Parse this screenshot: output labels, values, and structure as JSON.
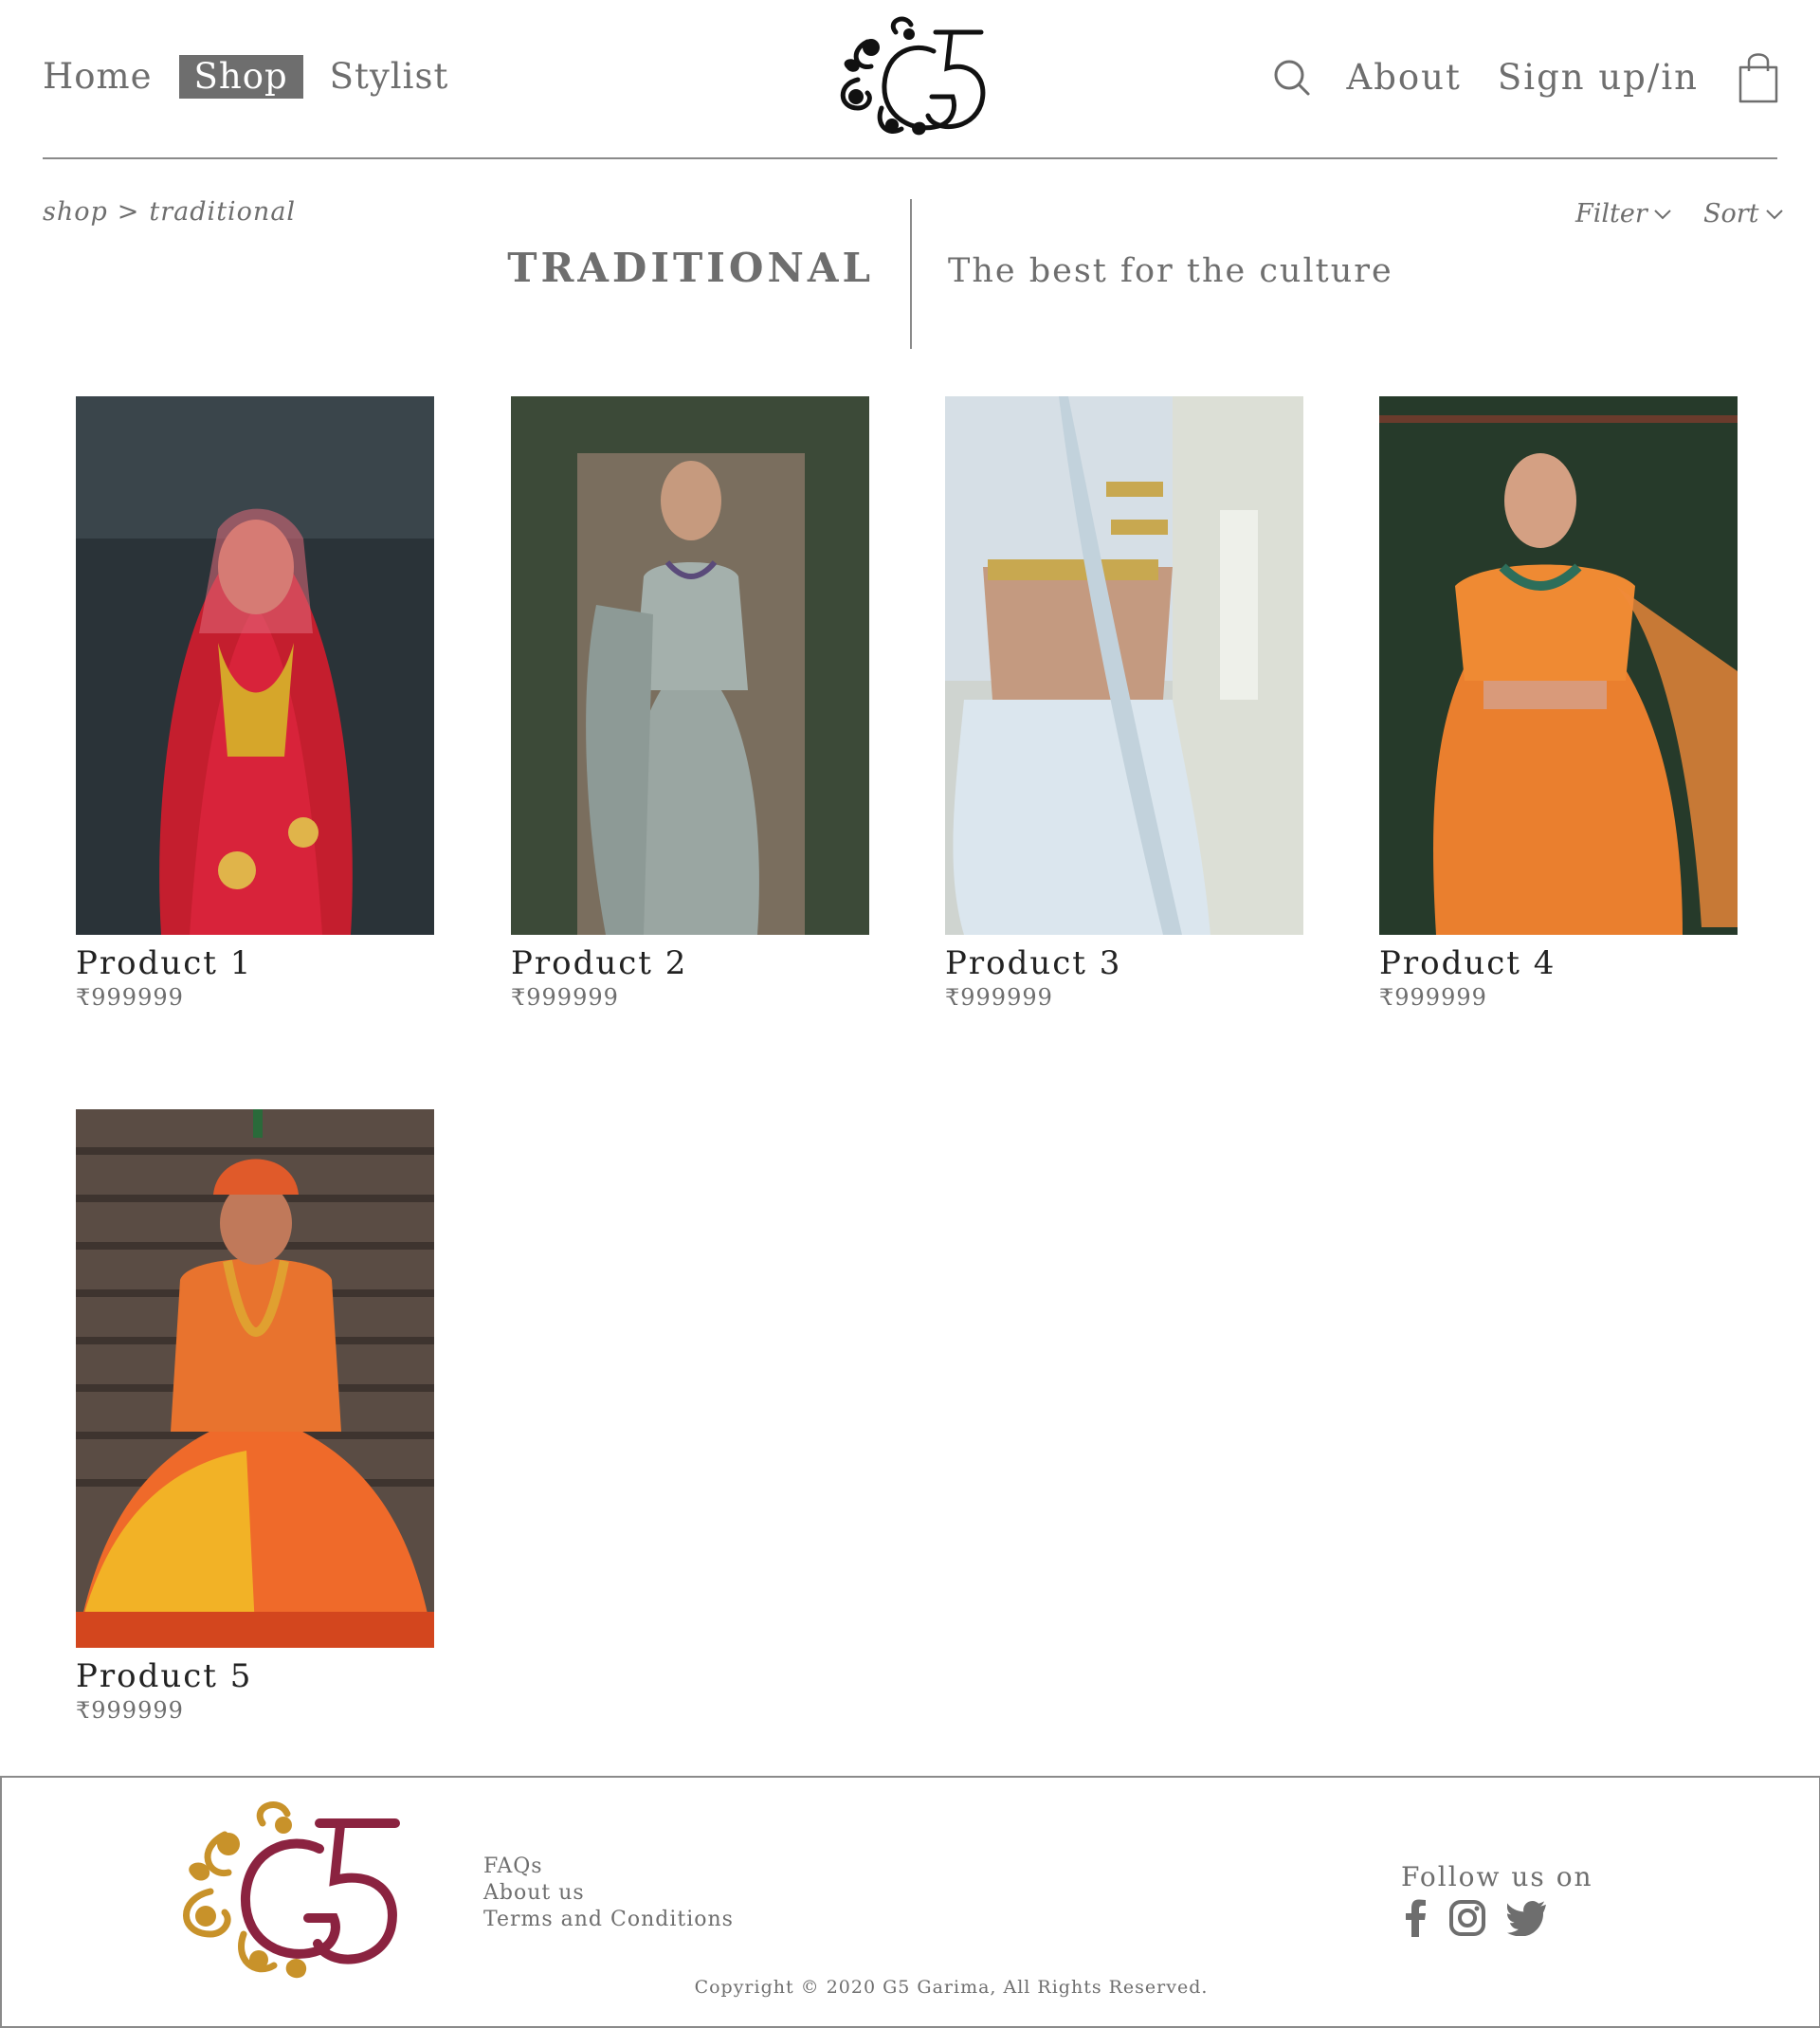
{
  "nav": {
    "home": "Home",
    "shop": "Shop",
    "stylist": "Stylist",
    "about": "About",
    "signup": "Sign up/in"
  },
  "breadcrumb": {
    "root": "shop",
    "sep": ">",
    "current": "traditional"
  },
  "page": {
    "title": "TRADITIONAL",
    "tagline": "The best for the culture"
  },
  "controls": {
    "filter": "Filter",
    "sort": "Sort"
  },
  "products": [
    {
      "name": "Product 1",
      "price": "₹999999"
    },
    {
      "name": "Product 2",
      "price": "₹999999"
    },
    {
      "name": "Product 3",
      "price": "₹999999"
    },
    {
      "name": "Product 4",
      "price": "₹999999"
    },
    {
      "name": "Product 5",
      "price": "₹999999"
    }
  ],
  "footer": {
    "links": [
      "FAQs",
      "About us",
      "Terms and Conditions"
    ],
    "follow": "Follow us on",
    "copyright": "Copyright © 2020 G5 Garima, All Rights Reserved."
  },
  "colors": {
    "text": "#6e6e6e",
    "logo_gold": "#c8922a",
    "logo_maroon": "#8b2340"
  },
  "icons": [
    "search-icon",
    "shopping-bag-icon",
    "chevron-down-icon",
    "facebook-icon",
    "instagram-icon",
    "twitter-icon"
  ]
}
